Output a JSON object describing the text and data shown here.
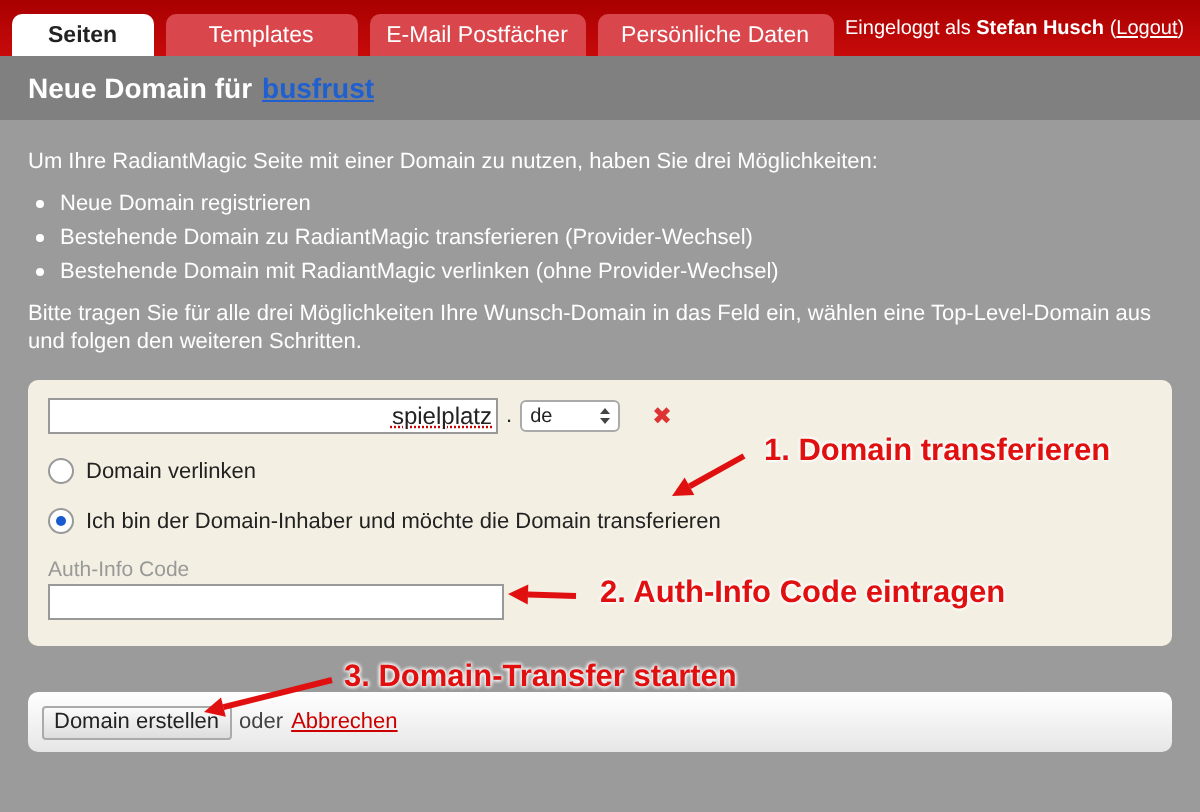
{
  "tabs": [
    {
      "label": "Seiten",
      "selected": true
    },
    {
      "label": "Templates",
      "selected": false
    },
    {
      "label": "E-Mail Postfächer",
      "selected": false
    },
    {
      "label": "Persönliche Daten",
      "selected": false
    }
  ],
  "login": {
    "prefix": "Eingeloggt als",
    "user": "Stefan Husch",
    "open": "(",
    "link": "Logout",
    "close": ")"
  },
  "title": {
    "text": "Neue Domain für",
    "link": "busfrust"
  },
  "intro": "Um Ihre RadiantMagic Seite mit einer Domain zu nutzen, haben Sie drei Möglichkeiten:",
  "options": [
    "Neue Domain registrieren",
    "Bestehende Domain zu RadiantMagic transferieren (Provider-Wechsel)",
    "Bestehende Domain mit RadiantMagic verlinken (ohne Provider-Wechsel)"
  ],
  "instructions": "Bitte tragen Sie für alle drei Möglichkeiten Ihre Wunsch-Domain in das Feld ein, wählen eine Top-Level-Domain aus und folgen den weiteren Schritten.",
  "form": {
    "domain_value": "spielplatz",
    "dot": ".",
    "tld": "de",
    "remove": "✖",
    "radios": [
      {
        "label": "Domain verlinken",
        "selected": false
      },
      {
        "label": "Ich bin der Domain-Inhaber und möchte die Domain transferieren",
        "selected": true
      }
    ],
    "auth_label": "Auth-Info Code"
  },
  "footer": {
    "button": "Domain erstellen",
    "or": "oder",
    "cancel": "Abbrechen"
  },
  "annotations": [
    "1. Domain transferieren",
    "2. Auth-Info Code eintragen",
    "3. Domain-Transfer starten"
  ]
}
